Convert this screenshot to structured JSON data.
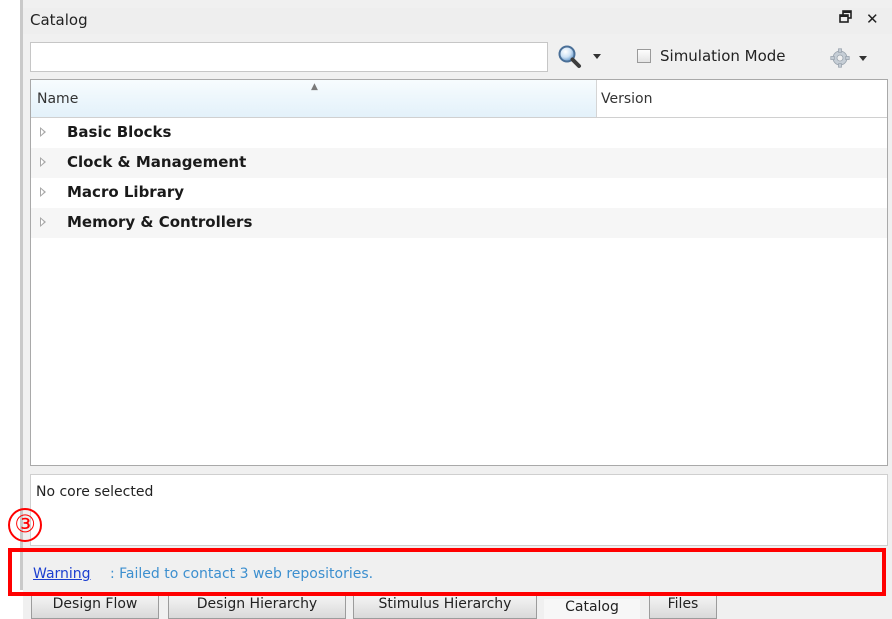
{
  "panel": {
    "title": "Catalog",
    "float_icon": "float-window-icon",
    "close_glyph": "✕"
  },
  "toolbar": {
    "search_value": "",
    "search_icon": "magnifier-icon",
    "simulation_mode_label": "Simulation Mode",
    "simulation_mode_checked": false,
    "settings_icon": "gear-icon"
  },
  "grid": {
    "columns": [
      "Name",
      "Version"
    ],
    "sort_column": "Name",
    "rows": [
      {
        "label": "Basic Blocks",
        "version": ""
      },
      {
        "label": "Clock & Management",
        "version": ""
      },
      {
        "label": "Macro Library",
        "version": ""
      },
      {
        "label": "Memory & Controllers",
        "version": ""
      }
    ]
  },
  "details": {
    "text": "No core selected"
  },
  "status": {
    "warning_link": "Warning",
    "warning_message": ": Failed to contact 3 web repositories."
  },
  "tabs": [
    {
      "label": "Design Flow",
      "active": false
    },
    {
      "label": "Design Hierarchy",
      "active": false
    },
    {
      "label": "Stimulus Hierarchy",
      "active": false
    },
    {
      "label": "Catalog",
      "active": true
    },
    {
      "label": "Files",
      "active": false
    }
  ],
  "annotation": {
    "number": "③",
    "color": "#ff0000"
  },
  "colors": {
    "header_highlight": "#e3f1fa",
    "warning_link": "#1c3fd0",
    "warning_text": "#3c8fcf"
  }
}
